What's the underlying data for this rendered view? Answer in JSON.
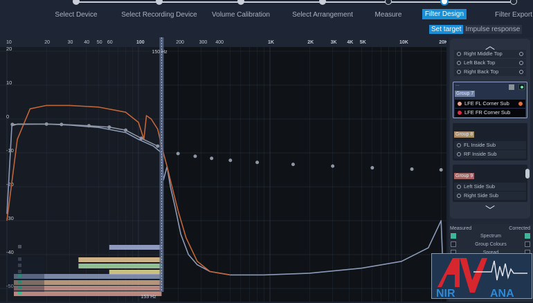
{
  "wizard": {
    "steps": [
      {
        "label": "Select Device",
        "state": "done"
      },
      {
        "label": "Select Recording Device",
        "state": "done"
      },
      {
        "label": "Volume Calibration",
        "state": "done"
      },
      {
        "label": "Select Arrangement",
        "state": "done"
      },
      {
        "label": "Measure",
        "state": "todo"
      },
      {
        "label": "Filter Design",
        "state": "active"
      },
      {
        "label": "Filter Export",
        "state": "todo"
      }
    ],
    "subtabs": {
      "set_target": "Set target",
      "impulse_response": "Impulse response"
    }
  },
  "graph": {
    "x_ticks": [
      "10",
      "20",
      "30",
      "40",
      "50",
      "60",
      "100",
      "200",
      "300",
      "400",
      "1K",
      "2K",
      "3K",
      "4K",
      "5K",
      "10K",
      "20K"
    ],
    "y_ticks": [
      "20",
      "10",
      "0",
      "-10",
      "-20",
      "-30",
      "-40",
      "-50"
    ],
    "crossover_top_label": "150 Hz",
    "crossover_bottom_label": "153 Hz",
    "colors": {
      "measured": "#8c9bb8",
      "corrected": "#c0663a",
      "target": "#8e96a3"
    }
  },
  "chart_data": {
    "type": "line",
    "x_scale": "log",
    "xlim": [
      10,
      22000
    ],
    "ylim": [
      -52,
      21
    ],
    "series": [
      {
        "key": "measured",
        "points": [
          [
            10,
            -28
          ],
          [
            10.9,
            -2
          ],
          [
            12,
            -1.5
          ],
          [
            20,
            -1.5
          ],
          [
            30,
            -1.8
          ],
          [
            50,
            -2.5
          ],
          [
            80,
            -4
          ],
          [
            100,
            -6
          ],
          [
            130,
            -8
          ],
          [
            150,
            -10
          ],
          [
            155,
            -18
          ],
          [
            165,
            -14
          ],
          [
            175,
            -20
          ],
          [
            190,
            -26
          ],
          [
            210,
            -34
          ],
          [
            240,
            -40
          ],
          [
            280,
            -43
          ],
          [
            350,
            -45
          ],
          [
            500,
            -46
          ],
          [
            900,
            -46
          ],
          [
            2000,
            -45.5
          ],
          [
            5000,
            -44
          ],
          [
            10000,
            -42
          ],
          [
            16000,
            -38
          ],
          [
            20000,
            -30
          ],
          [
            21000,
            -50
          ]
        ]
      },
      {
        "key": "corrected",
        "points": [
          [
            10,
            -30
          ],
          [
            12,
            -6
          ],
          [
            15,
            3
          ],
          [
            20,
            4
          ],
          [
            30,
            4
          ],
          [
            50,
            3.5
          ],
          [
            80,
            2
          ],
          [
            100,
            -1
          ],
          [
            110,
            -6
          ],
          [
            115,
            1
          ],
          [
            125,
            0
          ],
          [
            140,
            -3
          ],
          [
            150,
            -8
          ],
          [
            165,
            -14
          ],
          [
            180,
            -20
          ],
          [
            200,
            -27
          ],
          [
            230,
            -35
          ],
          [
            280,
            -42
          ],
          [
            350,
            -45
          ],
          [
            500,
            -46
          ]
        ]
      }
    ],
    "target": [
      [
        11,
        -1.6
      ],
      [
        20,
        -1.5
      ],
      [
        26,
        -1.6
      ],
      [
        42,
        -2
      ],
      [
        60,
        -2.4
      ],
      [
        80,
        -3.3
      ],
      [
        105,
        -5.7
      ],
      [
        140,
        -8
      ],
      [
        200,
        -10.2
      ],
      [
        270,
        -11
      ],
      [
        360,
        -11.6
      ],
      [
        500,
        -12.2
      ],
      [
        800,
        -12.8
      ],
      [
        1500,
        -13.4
      ],
      [
        3000,
        -13.9
      ],
      [
        6000,
        -14.4
      ],
      [
        12000,
        -14.8
      ],
      [
        20000,
        -15
      ]
    ]
  },
  "bands": [
    {
      "color": "#8e9ac0",
      "from": 60,
      "to": 150,
      "checked": false
    },
    {
      "color": "#cdb286",
      "from": 35,
      "to": 150,
      "checked": false
    },
    {
      "color": "#8fbf92",
      "from": 35,
      "to": 150,
      "checked": false
    },
    {
      "color": "#c8c07f",
      "from": 60,
      "to": 150,
      "checked": false
    },
    {
      "color": "#8e9ac0",
      "from": 10,
      "to": 150,
      "checked": true
    },
    {
      "color": "#d2a98a",
      "from": 10,
      "to": 150,
      "checked": true
    },
    {
      "color": "#d49a90",
      "from": 10,
      "to": 150,
      "checked": true
    },
    {
      "color": "#d49a90",
      "from": 10,
      "to": 150,
      "checked": true
    }
  ],
  "panel": {
    "top_rows": [
      "Right Middle Top",
      "Left Back Top",
      "Right Back Top"
    ],
    "group7": {
      "label": "Group 7",
      "dots": "...",
      "rows": [
        {
          "label": "LFE FL Corner Sub",
          "color": "#f0a090"
        },
        {
          "label": "LFE FR Corner Sub",
          "color": "#d8304a"
        }
      ]
    },
    "group8": {
      "label": "Group 8",
      "rows": [
        "FL Inside Sub",
        "RF Inside Sub"
      ]
    },
    "group9": {
      "label": "Group 9",
      "rows": [
        "Left Side Sub",
        "Right Side Sub"
      ]
    },
    "options": {
      "measured": "Measured",
      "corrected": "Corrected",
      "items": [
        {
          "label": "Spectrum",
          "measured": true,
          "corrected": true
        },
        {
          "label": "Group Colours",
          "measured": false,
          "corrected": false
        },
        {
          "label": "Spread",
          "measured": false,
          "corrected": false
        }
      ]
    }
  },
  "watermark": {
    "text": "AV NIRVANA"
  }
}
